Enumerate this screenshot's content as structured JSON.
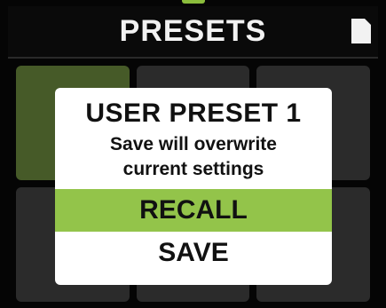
{
  "header": {
    "title": "PRESETS",
    "icon": "document-icon"
  },
  "grid": {
    "selected_index": 0,
    "cells": 6
  },
  "dialog": {
    "title": "USER PRESET 1",
    "message_line1": "Save will overwrite",
    "message_line2": "current settings",
    "options": [
      {
        "label": "RECALL",
        "highlighted": true
      },
      {
        "label": "SAVE",
        "highlighted": false
      }
    ]
  },
  "colors": {
    "accent": "#93c44a",
    "selected_cell": "#465a28",
    "background": "#050505"
  }
}
